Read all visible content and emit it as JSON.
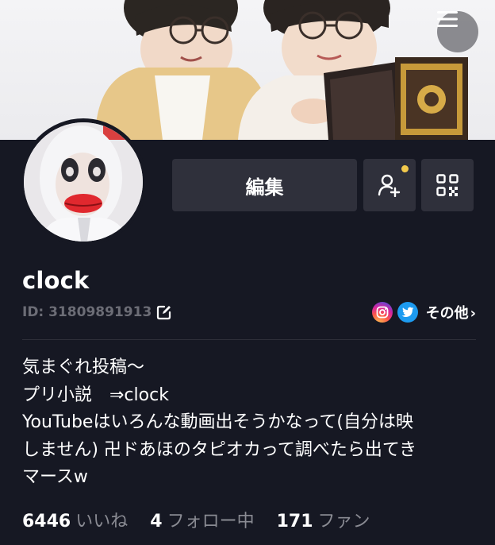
{
  "header": {
    "menu_icon": "hamburger-icon"
  },
  "actions": {
    "edit_label": "編集",
    "add_friend_icon": "add-user-icon",
    "qr_icon": "qr-code-icon",
    "notification_color": "#f2c94c"
  },
  "profile": {
    "username": "clock",
    "user_id": "ID: 31809891913",
    "others_label": "その他"
  },
  "bio": {
    "lines": [
      "気まぐれ投稿〜",
      "プリ小説　⇒clock",
      "YouTubeはいろんな動画出そうかなって(自分は映",
      "しません) 卍ドあほのタピオカって調べたら出てき",
      "マースw"
    ]
  },
  "stats": {
    "likes_count": "6446",
    "likes_label": "いいね",
    "following_count": "4",
    "following_label": "フォロー中",
    "followers_count": "171",
    "followers_label": "ファン"
  },
  "colors": {
    "background": "#161823",
    "button": "#2f303b",
    "muted_text": "#6c6d76",
    "twitter": "#1d9bf0"
  }
}
